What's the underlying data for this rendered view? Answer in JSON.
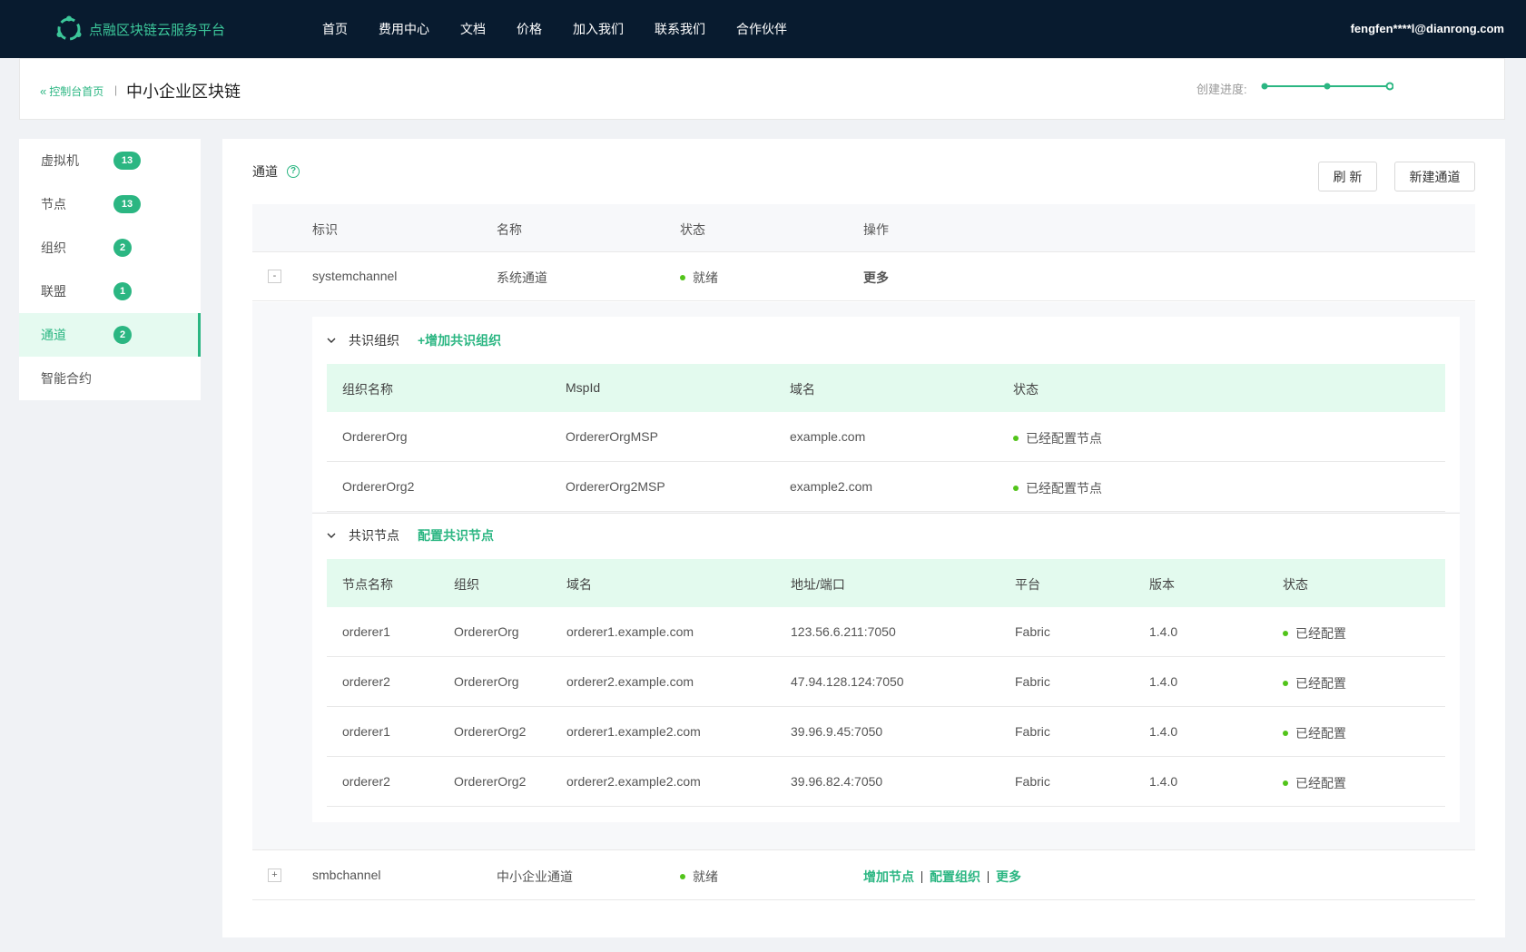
{
  "topbar": {
    "brand": "点融区块链云服务平台",
    "nav": [
      "首页",
      "费用中心",
      "文档",
      "价格",
      "加入我们",
      "联系我们",
      "合作伙伴"
    ],
    "user": "fengfen****l@dianrong.com"
  },
  "header": {
    "back_label": "控制台首页",
    "separator": "|",
    "title": "中小企业区块链",
    "progress_label": "创建进度:",
    "progress_steps_total": 3,
    "progress_steps_done": 3
  },
  "sidebar": {
    "items": [
      {
        "label": "虚拟机",
        "count": "13"
      },
      {
        "label": "节点",
        "count": "13"
      },
      {
        "label": "组织",
        "count": "2"
      },
      {
        "label": "联盟",
        "count": "1"
      },
      {
        "label": "通道",
        "count": "2"
      },
      {
        "label": "智能合约",
        "count": null
      }
    ],
    "active_index": 4
  },
  "main": {
    "section_title": "通道",
    "refresh_label": "刷 新",
    "create_label": "新建通道",
    "columns": [
      "标识",
      "名称",
      "状态",
      "操作"
    ],
    "channels": [
      {
        "expand_symbol": "-",
        "id": "systemchannel",
        "name": "系统通道",
        "status": "就绪",
        "actions": [
          "更多"
        ]
      },
      {
        "expand_symbol": "+",
        "id": "smbchannel",
        "name": "中小企业通道",
        "status": "就绪",
        "actions": [
          "增加节点",
          "配置组织",
          "更多"
        ]
      }
    ],
    "consensus_orgs": {
      "title": "共识组织",
      "action": "+增加共识组织",
      "columns": [
        "组织名称",
        "MspId",
        "域名",
        "状态"
      ],
      "rows": [
        [
          "OrdererOrg",
          "OrdererOrgMSP",
          "example.com",
          "已经配置节点"
        ],
        [
          "OrdererOrg2",
          "OrdererOrg2MSP",
          "example2.com",
          "已经配置节点"
        ]
      ]
    },
    "consensus_nodes": {
      "title": "共识节点",
      "action": "配置共识节点",
      "columns": [
        "节点名称",
        "组织",
        "域名",
        "地址/端口",
        "平台",
        "版本",
        "状态"
      ],
      "rows": [
        [
          "orderer1",
          "OrdererOrg",
          "orderer1.example.com",
          "123.56.6.211:7050",
          "Fabric",
          "1.4.0",
          "已经配置"
        ],
        [
          "orderer2",
          "OrdererOrg",
          "orderer2.example.com",
          "47.94.128.124:7050",
          "Fabric",
          "1.4.0",
          "已经配置"
        ],
        [
          "orderer1",
          "OrdererOrg2",
          "orderer1.example2.com",
          "39.96.9.45:7050",
          "Fabric",
          "1.4.0",
          "已经配置"
        ],
        [
          "orderer2",
          "OrdererOrg2",
          "orderer2.example2.com",
          "39.96.82.4:7050",
          "Fabric",
          "1.4.0",
          "已经配置"
        ]
      ]
    }
  },
  "colors": {
    "accent": "#2bb682",
    "topbar_bg": "#081b2f",
    "status_dot": "#52c41a",
    "sub_header_bg": "#e3faee"
  }
}
